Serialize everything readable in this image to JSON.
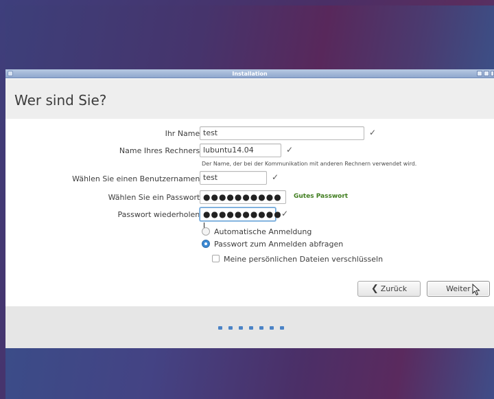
{
  "window": {
    "title": "Installation"
  },
  "page": {
    "heading": "Wer sind Sie?"
  },
  "form": {
    "name": {
      "label": "Ihr Name:",
      "value": "test",
      "valid": true
    },
    "computer": {
      "label": "Name Ihres Rechners:",
      "value": "lubuntu14.04",
      "valid": true,
      "hint": "Der Name, der bei der Kommunikation mit anderen Rechnern verwendet wird."
    },
    "username": {
      "label": "Wählen Sie einen Benutzernamen:",
      "value": "test",
      "valid": true
    },
    "password": {
      "label": "Wählen Sie ein Passwort:",
      "value": "●●●●●●●●●●",
      "strength": "Gutes Passwort"
    },
    "password_repeat": {
      "label": "Passwort wiederholen:",
      "value": "●●●●●●●●●●",
      "valid": true
    },
    "login_options": [
      {
        "label": "Automatische Anmeldung",
        "selected": false
      },
      {
        "label": "Passwort zum Anmelden abfragen",
        "selected": true
      }
    ],
    "encrypt_home": {
      "label": "Meine persönlichen Dateien verschlüsseln",
      "checked": false
    }
  },
  "buttons": {
    "back": "Zurück",
    "next": "Weiter"
  },
  "icons": {
    "check": "checkmark-icon",
    "back": "chevron-left-icon",
    "cursor": "mouse-pointer-icon"
  },
  "progress": {
    "steps": 7
  },
  "colors": {
    "accent": "#3d8ad4",
    "strength_good": "#3f7d1e",
    "progress": "#4b83c6"
  }
}
